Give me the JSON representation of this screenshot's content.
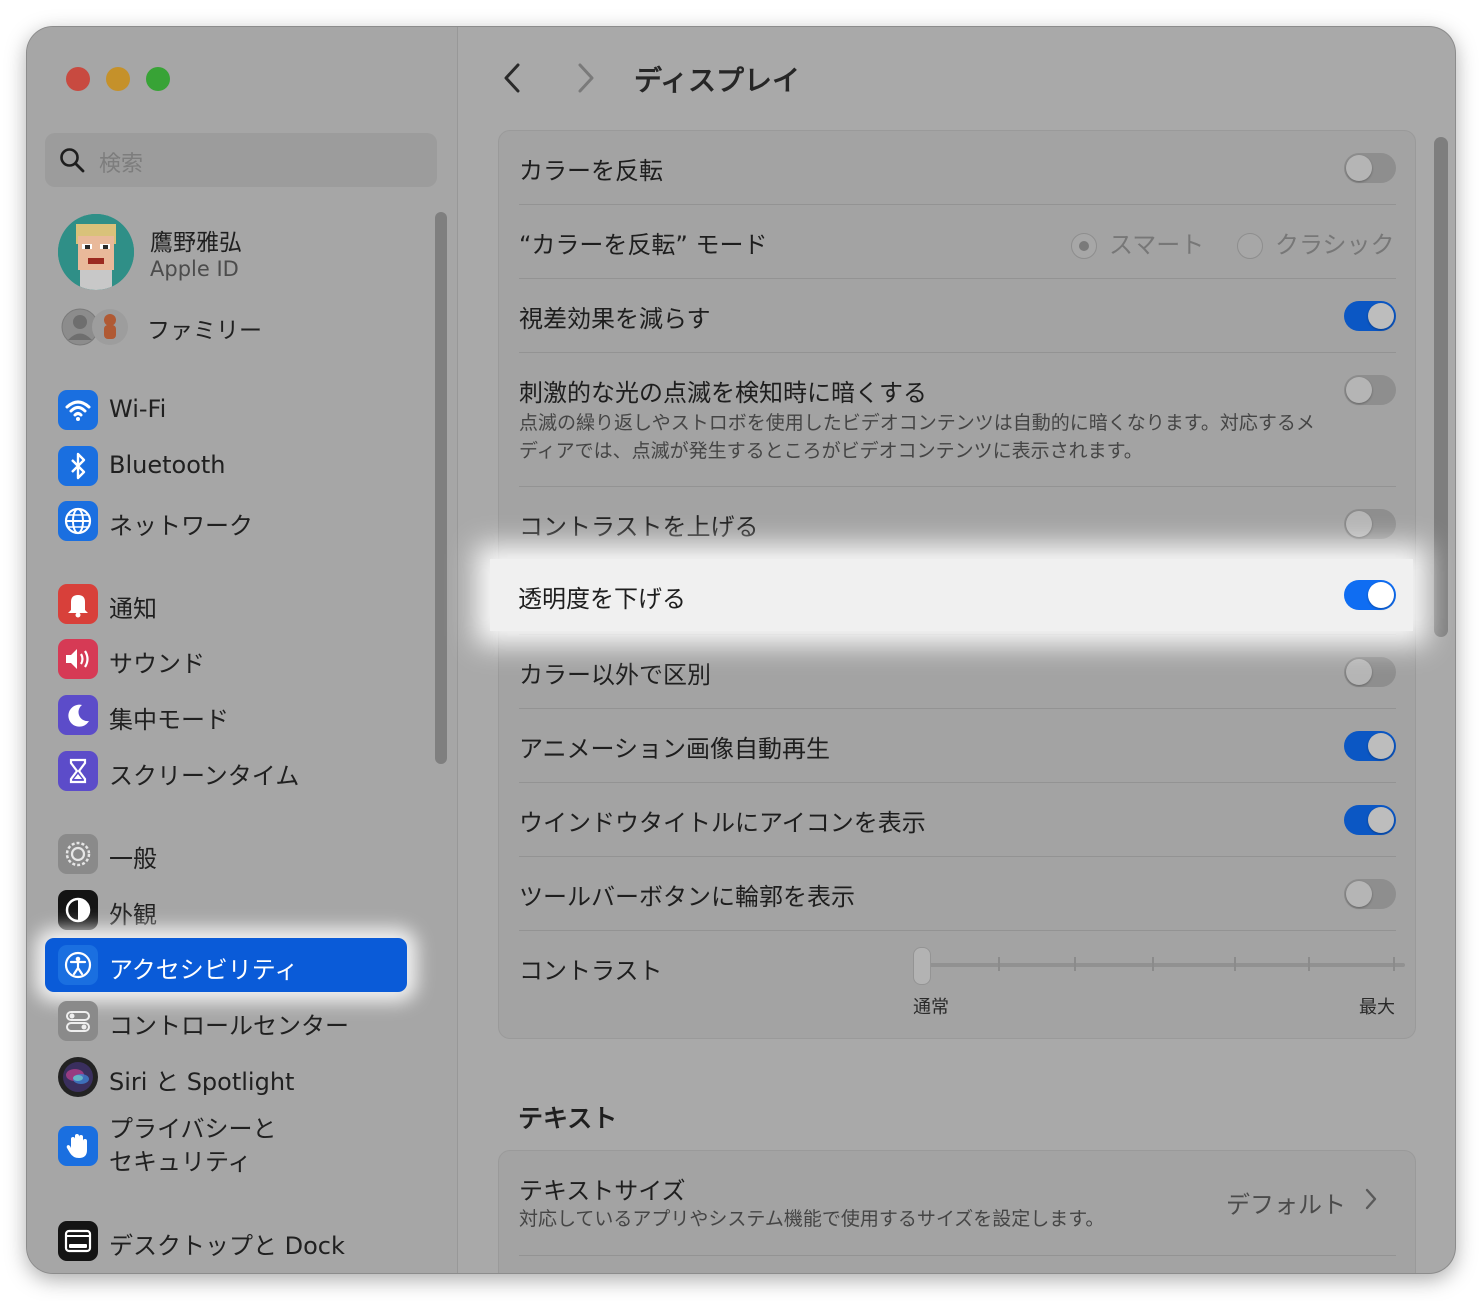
{
  "sidebar": {
    "search_placeholder": "検索",
    "profile": {
      "name": "鷹野雅弘",
      "subtitle": "Apple ID"
    },
    "family_label": "ファミリー",
    "items": [
      {
        "label": "Wi-Fi",
        "icon": "wifi-icon",
        "color": "#1a6fe0"
      },
      {
        "label": "Bluetooth",
        "icon": "bluetooth-icon",
        "color": "#1a6fe0"
      },
      {
        "label": "ネットワーク",
        "icon": "globe-icon",
        "color": "#1a6fe0"
      },
      {
        "label": "通知",
        "icon": "bell-icon",
        "color": "#d8403a"
      },
      {
        "label": "サウンド",
        "icon": "speaker-icon",
        "color": "#d63a55"
      },
      {
        "label": "集中モード",
        "icon": "moon-icon",
        "color": "#5c4cc9"
      },
      {
        "label": "スクリーンタイム",
        "icon": "hourglass-icon",
        "color": "#5c4cc9"
      },
      {
        "label": "一般",
        "icon": "gear-icon",
        "color": "#8a8a8a"
      },
      {
        "label": "外観",
        "icon": "appearance-icon",
        "color": "#141414"
      },
      {
        "label": "アクセシビリティ",
        "icon": "accessibility-icon",
        "color": "#1a6fe0"
      },
      {
        "label": "コントロールセンター",
        "icon": "control-center-icon",
        "color": "#8a8a8a"
      },
      {
        "label": "Siri と Spotlight",
        "icon": "siri-icon",
        "color": "#222222"
      },
      {
        "label": "プライバシーと\nセキュリティ",
        "icon": "hand-icon",
        "color": "#1a6fe0"
      },
      {
        "label": "デスクトップと Dock",
        "icon": "dock-icon",
        "color": "#141414"
      }
    ]
  },
  "main": {
    "title": "ディスプレイ",
    "rows": [
      {
        "label": "カラーを反転",
        "toggle": false
      },
      {
        "label": "“カラーを反転” モード",
        "options": [
          "スマート",
          "クラシック"
        ],
        "selected": "スマート"
      },
      {
        "label": "視差効果を減らす",
        "toggle": true
      },
      {
        "label": "刺激的な光の点滅を検知時に暗くする",
        "toggle": false,
        "description": "点滅の繰り返しやストロボを使用したビデオコンテンツは自動的に暗くなります。対応するメディアでは、点滅が発生するところがビデオコンテンツに表示されます。"
      },
      {
        "label": "コントラストを上げる",
        "toggle": false
      },
      {
        "label": "透明度を下げる",
        "toggle": true
      },
      {
        "label": "カラー以外で区別",
        "toggle": false
      },
      {
        "label": "アニメーション画像自動再生",
        "toggle": true
      },
      {
        "label": "ウインドウタイトルにアイコンを表示",
        "toggle": true
      },
      {
        "label": "ツールバーボタンに輪郭を表示",
        "toggle": false
      }
    ],
    "contrast": {
      "label": "コントラスト",
      "min_label": "通常",
      "max_label": "最大",
      "value": 0
    },
    "text_section": {
      "title": "テキスト",
      "text_size": {
        "label": "テキストサイズ",
        "description": "対応しているアプリやシステム機能で使用するサイズを設定します。",
        "value": "デフォルト"
      }
    }
  }
}
